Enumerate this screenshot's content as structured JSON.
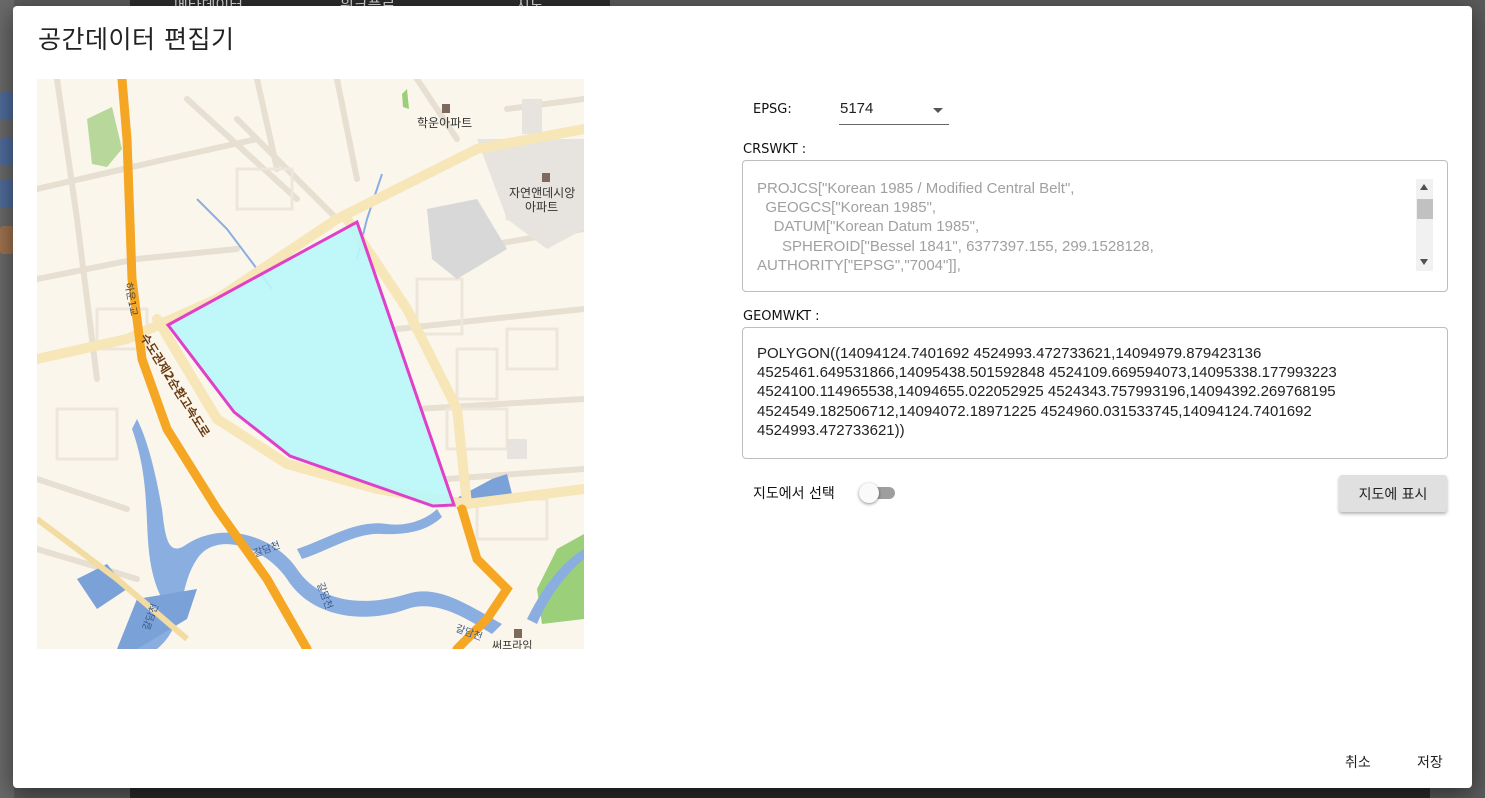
{
  "background": {
    "tabs": [
      "메타데이터",
      "워크플로",
      "지도"
    ]
  },
  "dialog": {
    "title": "공간데이터 편집기"
  },
  "map": {
    "labels": [
      {
        "text": "학운아파트"
      },
      {
        "text": "자연앤데시앙"
      },
      {
        "text": "아파트"
      },
      {
        "text": "하운1교"
      },
      {
        "text": "수도권제2순환고속도로"
      },
      {
        "text": "갈담천"
      },
      {
        "text": "갈담천"
      },
      {
        "text": "갈담천"
      },
      {
        "text": "갈담천"
      },
      {
        "text": "써프라임"
      }
    ],
    "polygon_fill": "#b9f7fb",
    "polygon_stroke": "#e040c8",
    "highway_color": "#f5a623",
    "water_color": "#8aaee0",
    "park_color": "#9ccf7a"
  },
  "form": {
    "epsg_label": "EPSG:",
    "epsg_value": "5174",
    "crswkt_label": "CRSWKT :",
    "crswkt_text": "PROJCS[\"Korean 1985 / Modified Central Belt\",\n  GEOGCS[\"Korean 1985\",\n    DATUM[\"Korean Datum 1985\",\n      SPHEROID[\"Bessel 1841\", 6377397.155, 299.1528128,\nAUTHORITY[\"EPSG\",\"7004\"]],",
    "geomwkt_label": "GEOMWKT :",
    "geomwkt_text": "POLYGON((14094124.7401692 4524993.472733621,14094979.879423136\n4525461.649531866,14095438.501592848 4524109.669594073,14095338.177993223\n4524100.114965538,14094655.022052925 4524343.757993196,14094392.269768195\n4524549.182506712,14094072.18971225 4524960.031533745,14094124.7401692\n4524993.472733621))",
    "toggle_label": "지도에서 선택",
    "toggle_on": false,
    "show_on_map_button": "지도에 표시"
  },
  "actions": {
    "cancel": "취소",
    "save": "저장"
  }
}
